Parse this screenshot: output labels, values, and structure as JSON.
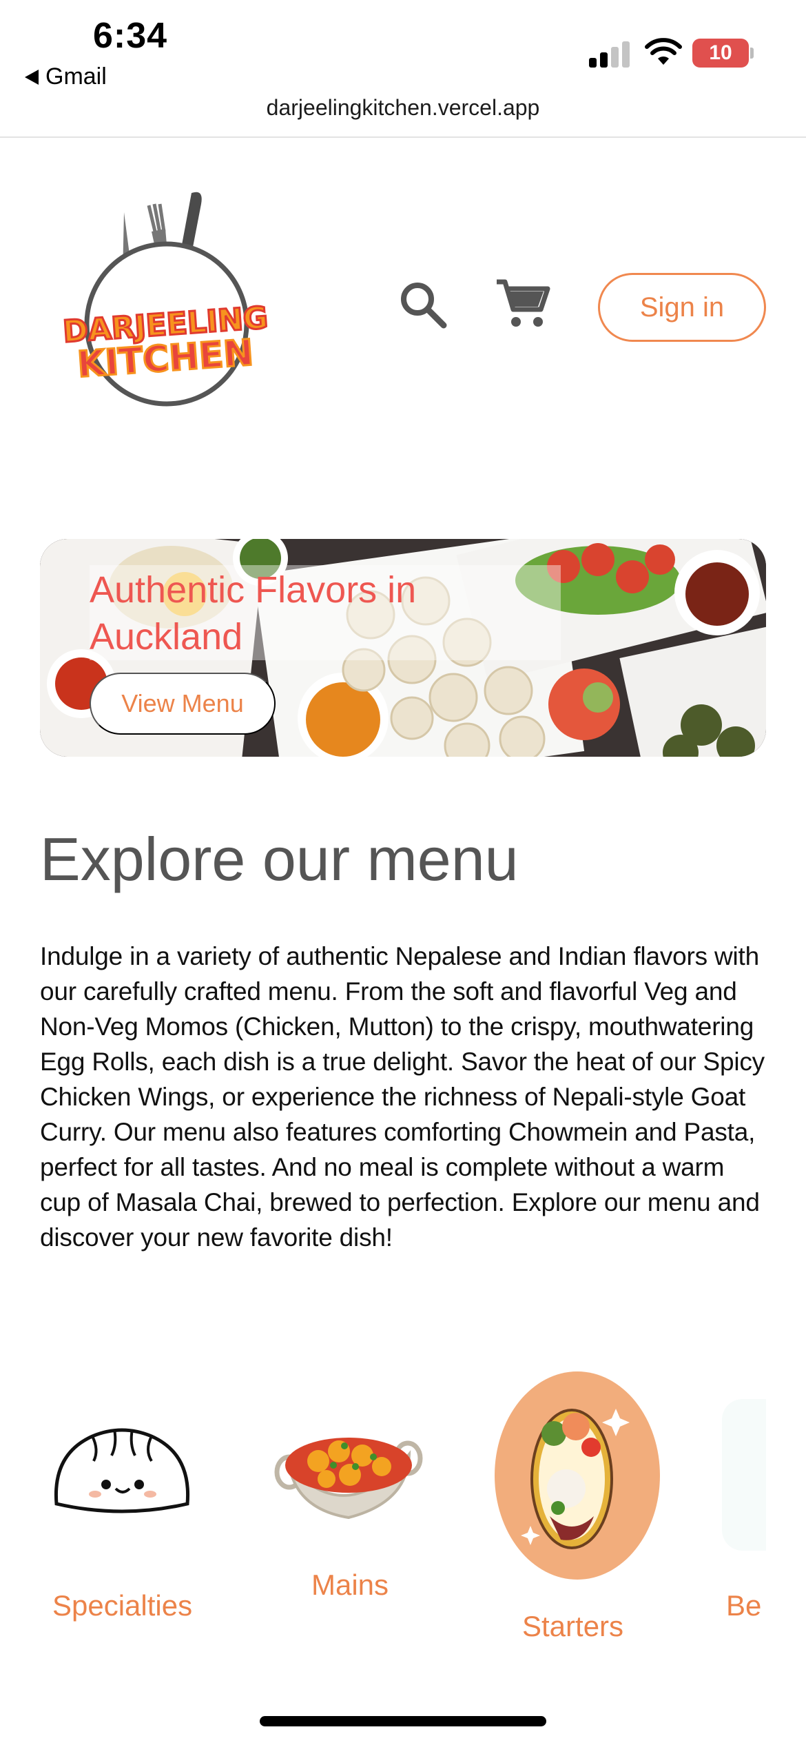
{
  "status_bar": {
    "time": "6:34",
    "back_app": "Gmail",
    "battery": "10",
    "url": "darjeelingkitchen.vercel.app",
    "icons": [
      "signal-icon",
      "wifi-icon",
      "battery-icon"
    ]
  },
  "header": {
    "logo_line1": "DARJEELING",
    "logo_line2": "KITCHEN",
    "icons": [
      "search-icon",
      "cart-icon"
    ],
    "sign_in_label": "Sign in"
  },
  "hero": {
    "title": "Authentic Flavors in Auckland",
    "cta_label": "View Menu"
  },
  "explore": {
    "title": "Explore our menu",
    "body": "Indulge in a variety of authentic Nepalese and Indian flavors with our carefully crafted menu. From the soft and flavorful Veg and Non-Veg Momos (Chicken, Mutton) to the crispy, mouthwatering Egg Rolls, each dish is a true delight. Savor the heat of our Spicy Chicken Wings, or experience the richness of Nepali-style Goat Curry. Our menu also features comforting Chowmein and Pasta, perfect for all tastes. And no meal is complete without a warm cup of Masala Chai, brewed to perfection. Explore our menu and discover your new favorite dish!"
  },
  "categories": [
    {
      "label": "Specialties",
      "icon": "momo-icon"
    },
    {
      "label": "Mains",
      "icon": "curry-bowl-icon"
    },
    {
      "label": "Starters",
      "icon": "bento-box-icon"
    },
    {
      "label": "Be",
      "icon": ""
    }
  ],
  "colors": {
    "accent": "#ec8349",
    "hero_title": "#ee5751",
    "battery_low": "#e0504e",
    "starters_bg": "#f2ad7c"
  }
}
